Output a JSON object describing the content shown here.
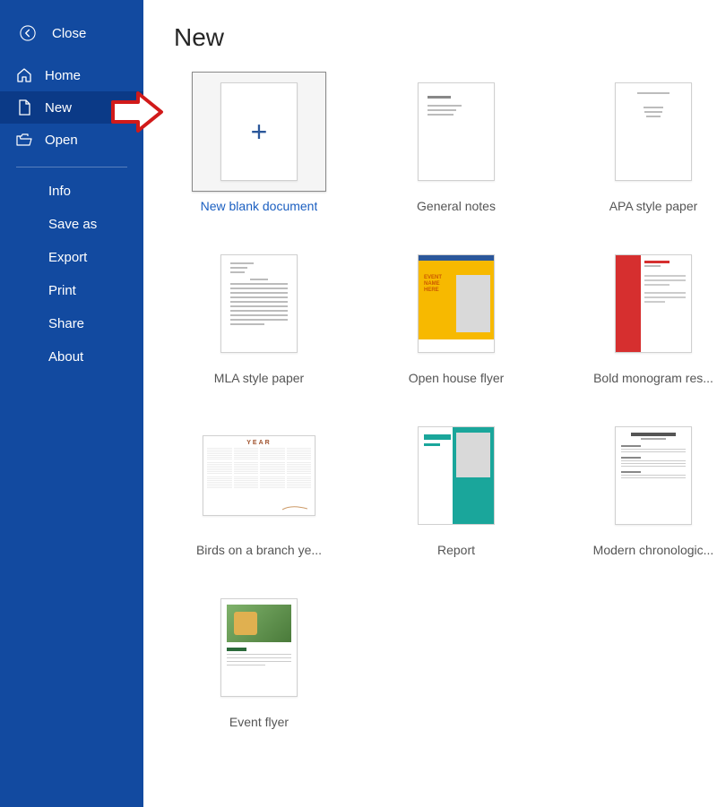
{
  "close": {
    "label": "Close"
  },
  "nav": {
    "home": "Home",
    "new": "New",
    "open": "Open"
  },
  "sub": {
    "info": "Info",
    "save_as": "Save as",
    "export": "Export",
    "print": "Print",
    "share": "Share",
    "about": "About"
  },
  "page": {
    "title": "New"
  },
  "templates": {
    "blank": "New blank document",
    "general_notes": "General notes",
    "apa": "APA style paper",
    "mla": "MLA style paper",
    "open_house": "Open house flyer",
    "bold_monogram": "Bold monogram res...",
    "birds": "Birds on a branch ye...",
    "report": "Report",
    "modern_chrono": "Modern chronologic...",
    "event_flyer": "Event flyer"
  },
  "calendar": {
    "year_label": "YEAR"
  }
}
